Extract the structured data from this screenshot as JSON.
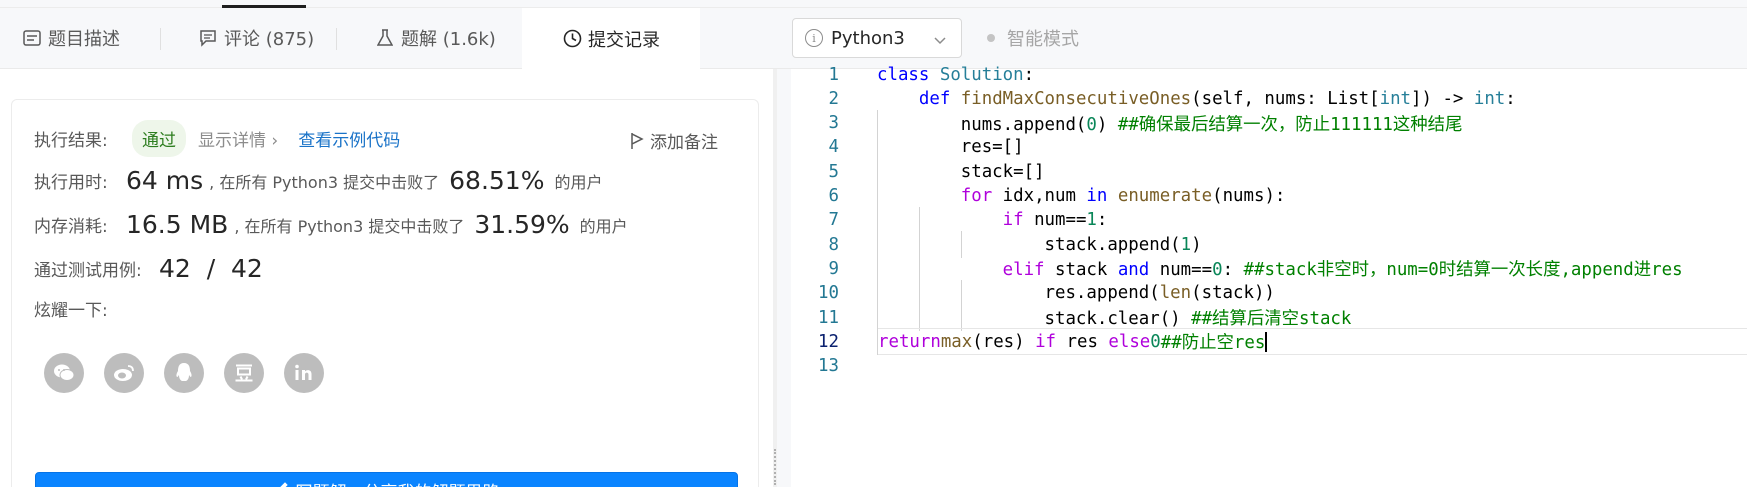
{
  "tabs": [
    {
      "label": "题目描述",
      "icon": "description-icon"
    },
    {
      "label": "评论 (875)",
      "icon": "comment-icon"
    },
    {
      "label": "题解 (1.6k)",
      "icon": "flask-icon"
    },
    {
      "label": "提交记录",
      "icon": "clock-icon"
    }
  ],
  "toolbar": {
    "language": "Python3",
    "smart_mode": "智能模式"
  },
  "result": {
    "exec_label": "执行结果:",
    "status": "通过",
    "show_detail": "显示详情 ›",
    "view_example": "查看示例代码",
    "add_note": "添加备注",
    "time_label": "执行用时:",
    "time_value": "64 ms",
    "time_text": ", 在所有 Python3 提交中击败了",
    "time_pct": "68.51%",
    "users": "的用户",
    "mem_label": "内存消耗:",
    "mem_value": "16.5 MB",
    "mem_text": ", 在所有 Python3 提交中击败了",
    "mem_pct": "31.59%",
    "tests_label": "通过测试用例:",
    "tests_value": "42  /  42",
    "share_label": "炫耀一下:",
    "share_icons": [
      "wechat-icon",
      "weibo-icon",
      "qq-icon",
      "douban-icon",
      "linkedin-icon"
    ],
    "write_solution": "写题解，分享我的解题思路"
  },
  "editor": {
    "current_line": 12,
    "lines": [
      {
        "n": "1",
        "code": "class Solution:"
      },
      {
        "n": "2",
        "code": "    def findMaxConsecutiveOnes(self, nums: List[int]) -> int:"
      },
      {
        "n": "3",
        "code": "        nums.append(0) ##确保最后结算一次，防止111111这种结尾"
      },
      {
        "n": "4",
        "code": "        res=[]"
      },
      {
        "n": "5",
        "code": "        stack=[]"
      },
      {
        "n": "6",
        "code": "        for idx,num in enumerate(nums):"
      },
      {
        "n": "7",
        "code": "            if num==1:"
      },
      {
        "n": "8",
        "code": "                stack.append(1)"
      },
      {
        "n": "9",
        "code": "            elif stack and num==0: ##stack非空时，num=0时结算一次长度,append进res"
      },
      {
        "n": "10",
        "code": "                res.append(len(stack))"
      },
      {
        "n": "11",
        "code": "                stack.clear() ##结算后清空stack"
      },
      {
        "n": "12",
        "code": "        return max(res) if res else 0  ##防止空res"
      },
      {
        "n": "13",
        "code": ""
      }
    ]
  },
  "colors": {
    "keyword": "#0000ff",
    "control": "#af00db",
    "func": "#795e26",
    "number": "#098658",
    "comment": "#008000",
    "builtin_type": "#267f99",
    "link": "#1a73c8",
    "button": "#0a84ff"
  }
}
